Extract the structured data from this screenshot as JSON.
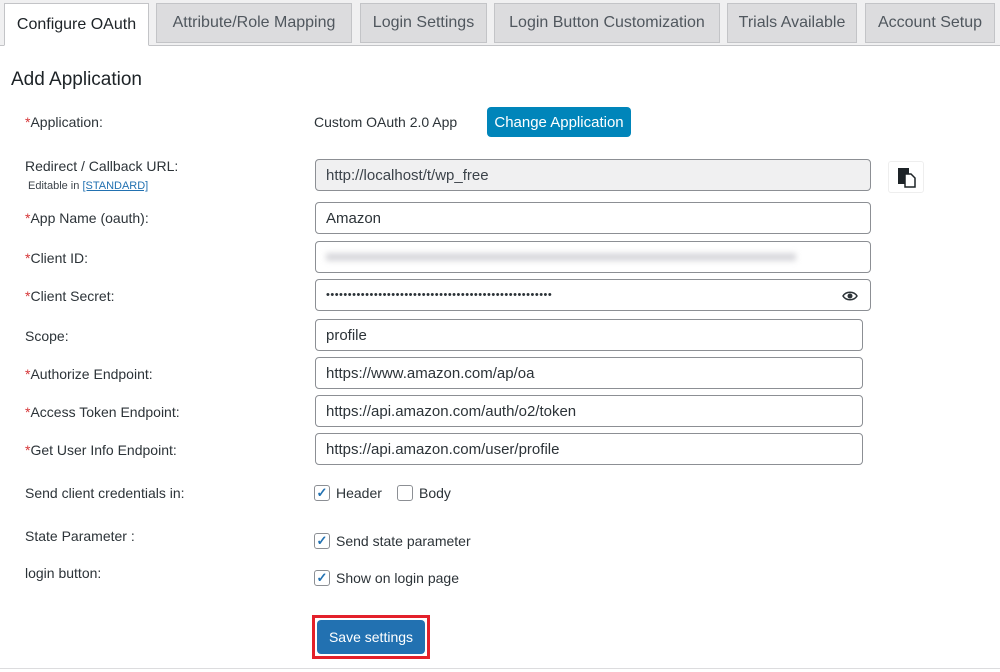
{
  "tabs": [
    {
      "label": "Configure OAuth",
      "active": true
    },
    {
      "label": "Attribute/Role Mapping"
    },
    {
      "label": "Login Settings"
    },
    {
      "label": "Login Button Customization"
    },
    {
      "label": "Trials Available"
    },
    {
      "label": "Account Setup"
    }
  ],
  "heading": "Add Application",
  "required_mark": "*",
  "application": {
    "label": "Application:",
    "value": "Custom OAuth 2.0 App",
    "button": "Change Application"
  },
  "redirect": {
    "label": "Redirect / Callback URL:",
    "note": "Editable in",
    "note_link": "[STANDARD]",
    "value": "http://localhost/t/wp_free"
  },
  "app_name": {
    "label": "App Name (oauth):",
    "value": "Amazon"
  },
  "client_id": {
    "label": "Client ID:"
  },
  "client_secret": {
    "label": "Client Secret:",
    "value": "••••••••••••••••••••••••••••••••••••••••••••••••••••"
  },
  "scope": {
    "label": "Scope:",
    "value": "profile"
  },
  "authorize": {
    "label": "Authorize Endpoint:",
    "value": "https://www.amazon.com/ap/oa"
  },
  "token": {
    "label": "Access Token Endpoint:",
    "value": "https://api.amazon.com/auth/o2/token"
  },
  "userinfo": {
    "label": "Get User Info Endpoint:",
    "value": "https://api.amazon.com/user/profile"
  },
  "credentials": {
    "label": "Send client credentials in:",
    "header": "Header",
    "header_checked": true,
    "body": "Body",
    "body_checked": false
  },
  "state": {
    "label": "State Parameter :",
    "option": "Send state parameter",
    "checked": true
  },
  "login_button": {
    "label": "login button:",
    "option": "Show on login page",
    "checked": true
  },
  "save": "Save settings",
  "colors": {
    "primary": "#0085ba",
    "save_button": "#2271b1",
    "highlight": "#e3202a",
    "required": "#d63638"
  }
}
